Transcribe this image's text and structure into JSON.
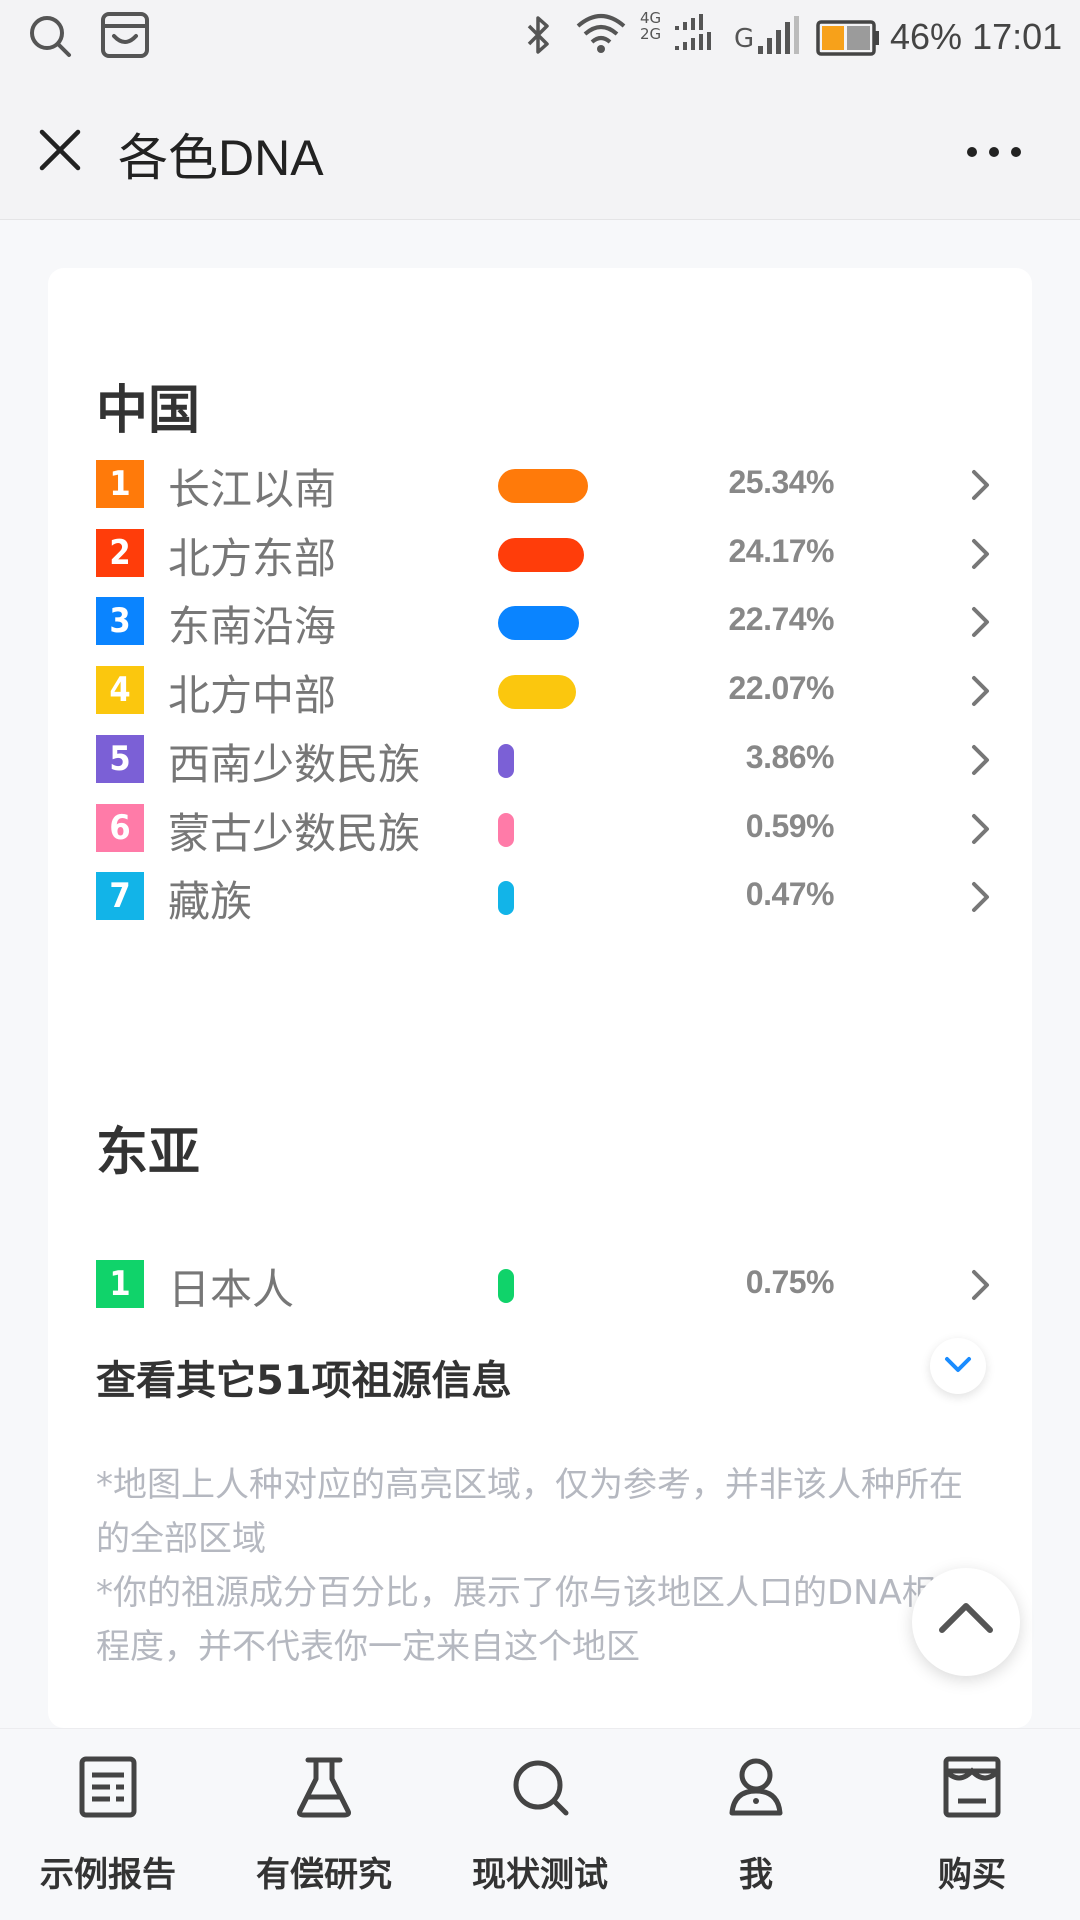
{
  "status_bar": {
    "network_4g": "4G",
    "network_2g": "2G",
    "network_g": "G",
    "battery_pct": "46%",
    "time": "17:01",
    "battery_level": 0.46
  },
  "nav": {
    "title": "各色DNA",
    "more_glyph": "•••"
  },
  "sections": [
    {
      "title": "中国",
      "rows": [
        {
          "rank": "1",
          "name": "长江以南",
          "percent": "25.34%",
          "value": 25.34,
          "color": "#ff7a0a"
        },
        {
          "rank": "2",
          "name": "北方东部",
          "percent": "24.17%",
          "value": 24.17,
          "color": "#ff3d0a"
        },
        {
          "rank": "3",
          "name": "东南沿海",
          "percent": "22.74%",
          "value": 22.74,
          "color": "#0a84ff"
        },
        {
          "rank": "4",
          "name": "北方中部",
          "percent": "22.07%",
          "value": 22.07,
          "color": "#fbc70e"
        },
        {
          "rank": "5",
          "name": "西南少数民族",
          "percent": "3.86%",
          "value": 3.86,
          "color": "#7b60d6"
        },
        {
          "rank": "6",
          "name": "蒙古少数民族",
          "percent": "0.59%",
          "value": 0.59,
          "color": "#ff7ba8"
        },
        {
          "rank": "7",
          "name": "藏族",
          "percent": "0.47%",
          "value": 0.47,
          "color": "#12b4e8"
        }
      ]
    },
    {
      "title": "东亚",
      "rows": [
        {
          "rank": "1",
          "name": "日本人",
          "percent": "0.75%",
          "value": 0.75,
          "color": "#10d36a"
        }
      ]
    }
  ],
  "more_link": "查看其它51项祖源信息",
  "disclaimer": [
    "*地图上人种对应的高亮区域，仅为参考，并非该人种所在的全部区域",
    "*你的祖源成分百分比，展示了你与该地区人口的DNA相似程度，并不代表你一定来自这个地区"
  ],
  "tabs": [
    {
      "label": "示例报告",
      "icon": "report-icon"
    },
    {
      "label": "有偿研究",
      "icon": "flask-icon"
    },
    {
      "label": "现状测试",
      "icon": "search-icon"
    },
    {
      "label": "我",
      "icon": "person-icon"
    },
    {
      "label": "购买",
      "icon": "store-icon"
    }
  ]
}
